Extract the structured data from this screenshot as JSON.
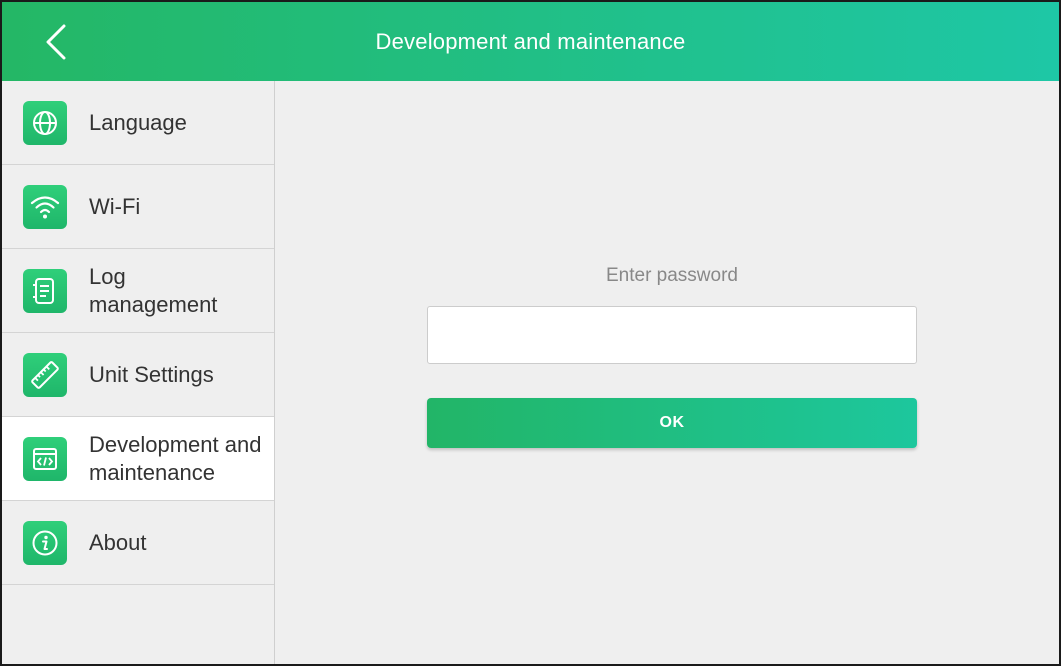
{
  "header": {
    "title": "Development and maintenance",
    "back_icon": "chevron-left-icon"
  },
  "sidebar": {
    "items": [
      {
        "label": "Language",
        "icon": "globe-icon",
        "active": false
      },
      {
        "label": "Wi-Fi",
        "icon": "wifi-icon",
        "active": false
      },
      {
        "label": "Log\nmanagement",
        "icon": "log-icon",
        "active": false
      },
      {
        "label": "Unit Settings",
        "icon": "ruler-icon",
        "active": false
      },
      {
        "label": "Development and\nmaintenance",
        "icon": "code-icon",
        "active": true
      },
      {
        "label": "About",
        "icon": "info-icon",
        "active": false
      }
    ]
  },
  "main": {
    "password_label": "Enter password",
    "password_value": "",
    "ok_label": "OK"
  },
  "colors": {
    "accent_start": "#24b765",
    "accent_end": "#1ec7a6",
    "icon_bg": "#2fcf7a",
    "background": "#efefef"
  }
}
